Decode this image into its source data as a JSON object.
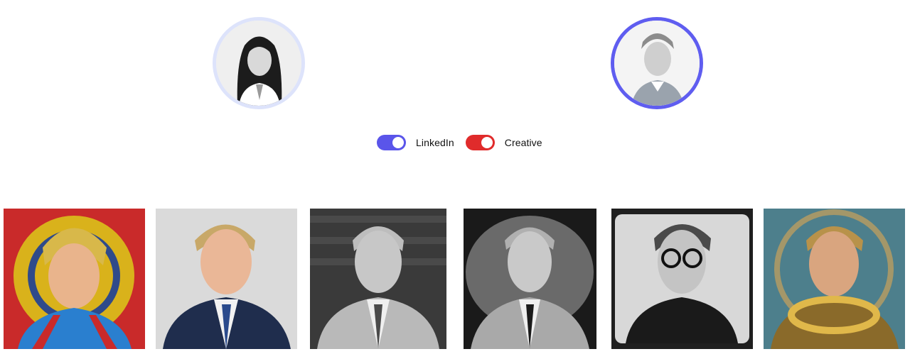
{
  "avatars": [
    {
      "name": "source-portrait-woman",
      "ring_color": "#dde3fb"
    },
    {
      "name": "source-portrait-man",
      "ring_color": "#5f5df0"
    }
  ],
  "toggles": [
    {
      "label": "LinkedIn",
      "on": true,
      "color": "#5a55ea"
    },
    {
      "label": "Creative",
      "on": true,
      "color": "#e02b2b"
    }
  ],
  "gallery": [
    {
      "style": "comic-art"
    },
    {
      "style": "color-professional"
    },
    {
      "style": "bw-professional"
    },
    {
      "style": "bw-dramatic"
    },
    {
      "style": "bw-glasses"
    },
    {
      "style": "fantasy-armor"
    }
  ]
}
